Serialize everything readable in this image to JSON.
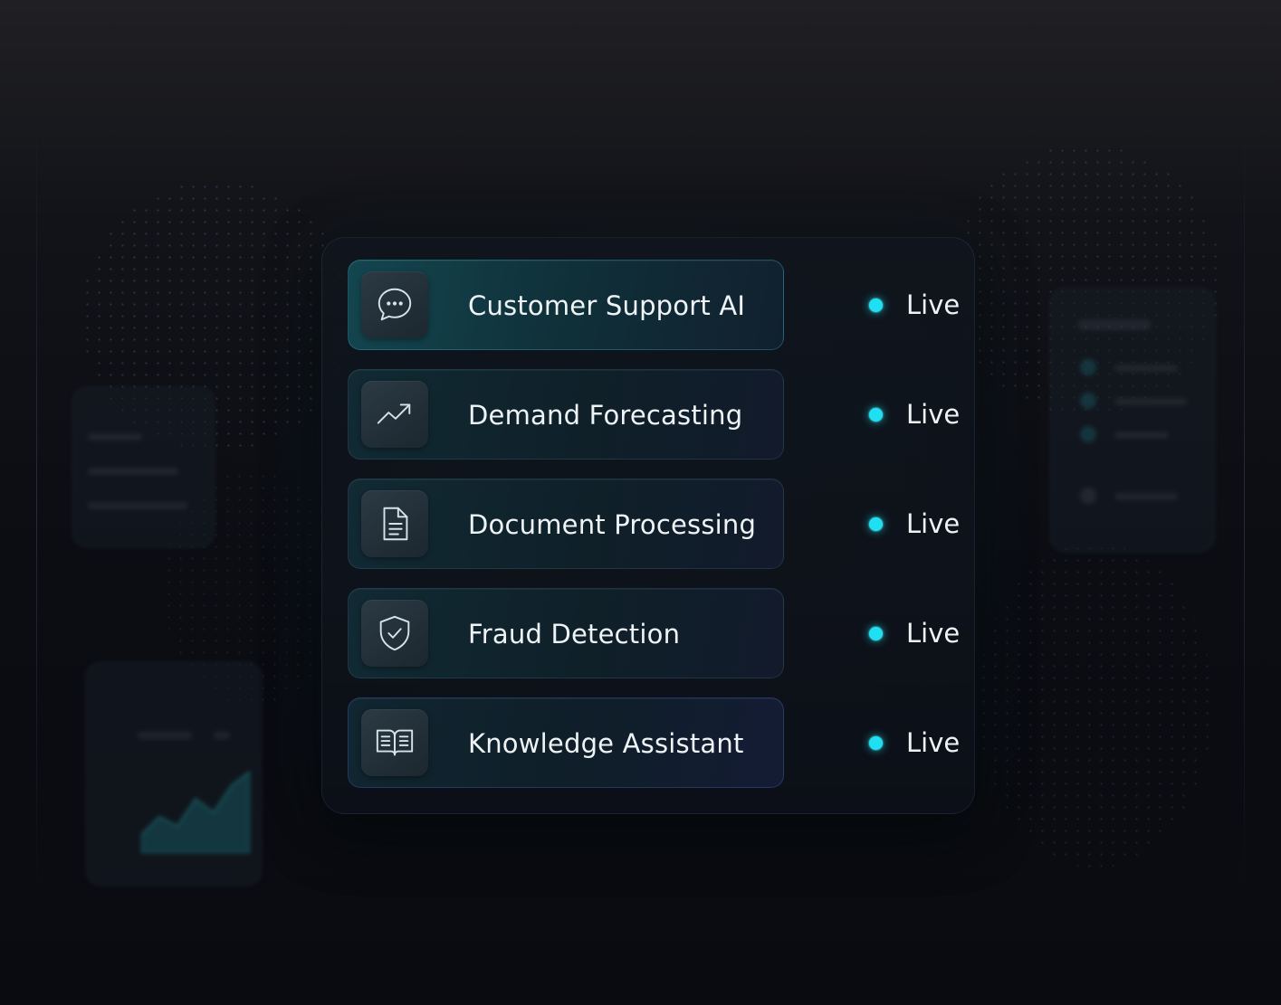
{
  "services": [
    {
      "name": "Customer Support AI",
      "icon": "chat-bubble-icon",
      "status": "Live"
    },
    {
      "name": "Demand Forecasting",
      "icon": "trending-up-icon",
      "status": "Live"
    },
    {
      "name": "Document Processing",
      "icon": "document-icon",
      "status": "Live"
    },
    {
      "name": "Fraud Detection",
      "icon": "shield-check-icon",
      "status": "Live"
    },
    {
      "name": "Knowledge Assistant",
      "icon": "open-book-icon",
      "status": "Live"
    }
  ],
  "colors": {
    "status_live": "#1fe0f2",
    "background": "#0b0c11",
    "text": "#eef3f6"
  }
}
